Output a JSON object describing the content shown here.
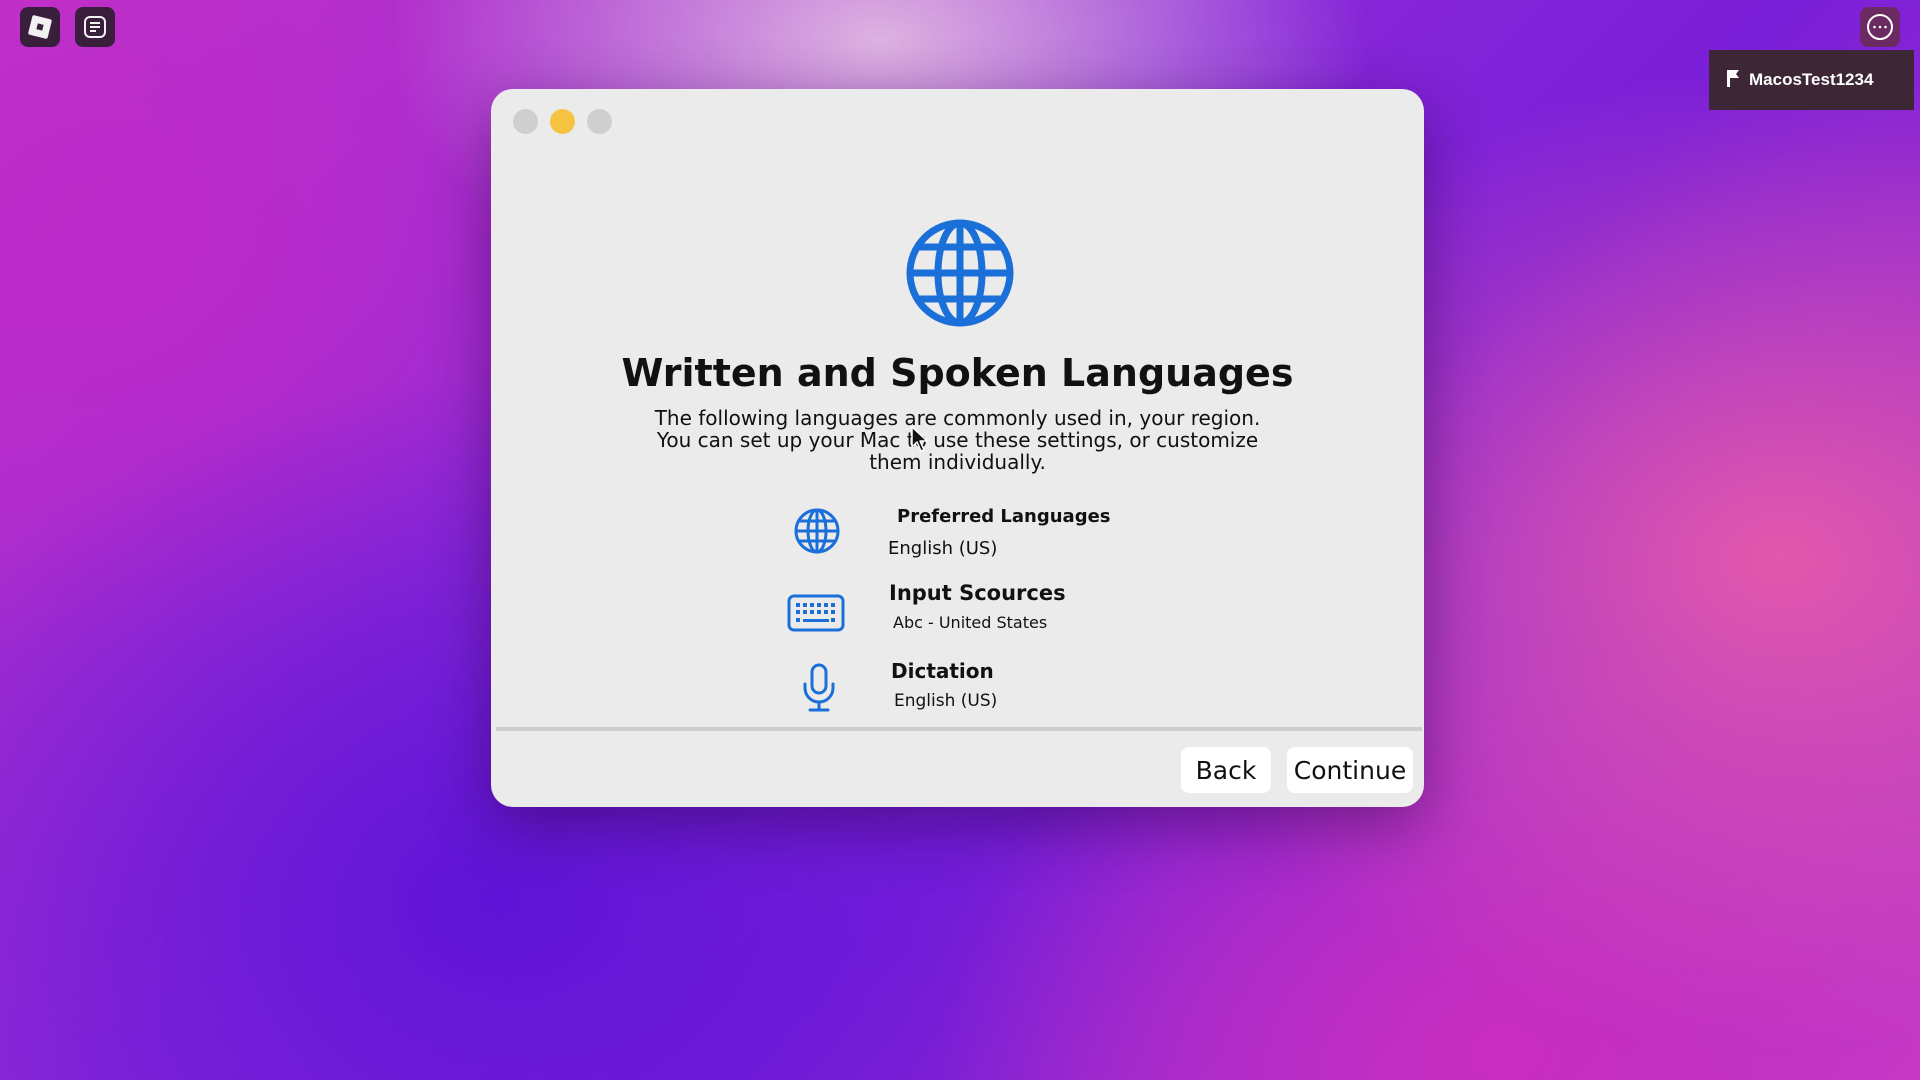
{
  "desktop": {
    "icons": [
      "app-launcher-icon",
      "notes-icon",
      "more-options-icon",
      "user-flag-icon"
    ],
    "user": {
      "name": "MacosTest1234"
    }
  },
  "dialog": {
    "title": "Written and Spoken Languages",
    "description": "The following languages are commonly used in, your region. You can set up your Mac to use these settings, or customize them individually.",
    "items": [
      {
        "icon": "globe-icon",
        "label": "Preferred Languages",
        "value": "English (US)"
      },
      {
        "icon": "keyboard-icon",
        "label": "Input Scources",
        "value": "Abc - United States"
      },
      {
        "icon": "microphone-icon",
        "label": "Dictation",
        "value": "English (US)"
      }
    ],
    "buttons": {
      "back": "Back",
      "continue": "Continue"
    },
    "colors": {
      "accent": "#1b6fd8",
      "minimize": "#f6c341"
    }
  }
}
